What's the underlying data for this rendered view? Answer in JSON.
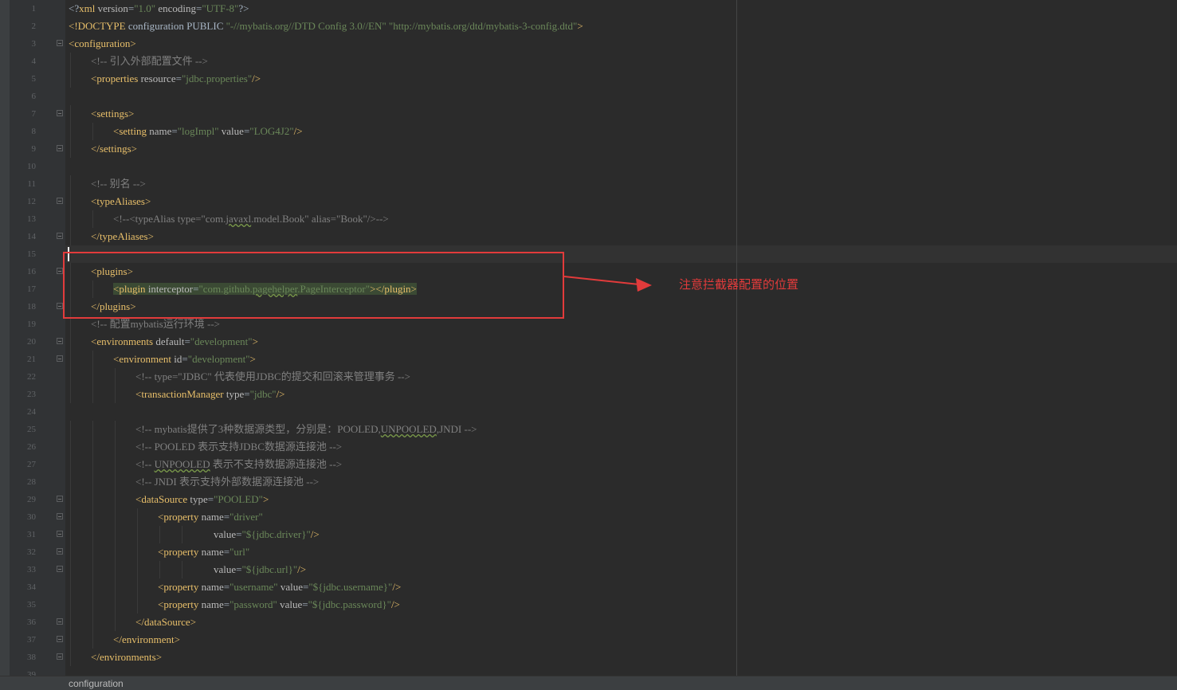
{
  "editor": {
    "lines": [
      {
        "n": "1",
        "indent": 0,
        "fold": false,
        "segments": [
          {
            "t": "p",
            "s": "<?"
          },
          {
            "t": "t",
            "s": "xml "
          },
          {
            "t": "a",
            "s": "version"
          },
          {
            "t": "p",
            "s": "="
          },
          {
            "t": "v",
            "s": "\"1.0\""
          },
          {
            "t": "p",
            "s": " "
          },
          {
            "t": "a",
            "s": "encoding"
          },
          {
            "t": "p",
            "s": "="
          },
          {
            "t": "v",
            "s": "\"UTF-8\""
          },
          {
            "t": "p",
            "s": "?>"
          }
        ]
      },
      {
        "n": "2",
        "indent": 0,
        "fold": false,
        "segments": [
          {
            "t": "t",
            "s": "<!DOCTYPE "
          },
          {
            "t": "p",
            "s": "configuration PUBLIC "
          },
          {
            "t": "v",
            "s": "\"-//mybatis.org//DTD Config 3.0//EN\" \"http://mybatis.org/dtd/mybatis-3-config.dtd\""
          },
          {
            "t": "t",
            "s": ">"
          }
        ]
      },
      {
        "n": "3",
        "indent": 0,
        "fold": true,
        "segments": [
          {
            "t": "t",
            "s": "<configuration>"
          }
        ]
      },
      {
        "n": "4",
        "indent": 1,
        "fold": false,
        "segments": [
          {
            "t": "c",
            "s": "<!-- 引入外部配置文件 -->"
          }
        ]
      },
      {
        "n": "5",
        "indent": 1,
        "fold": false,
        "segments": [
          {
            "t": "t",
            "s": "<properties "
          },
          {
            "t": "a",
            "s": "resource"
          },
          {
            "t": "p",
            "s": "="
          },
          {
            "t": "v",
            "s": "\"jdbc.properties\""
          },
          {
            "t": "t",
            "s": "/>"
          }
        ]
      },
      {
        "n": "6",
        "indent": 0,
        "fold": false,
        "segments": []
      },
      {
        "n": "7",
        "indent": 1,
        "fold": true,
        "segments": [
          {
            "t": "t",
            "s": "<settings>"
          }
        ]
      },
      {
        "n": "8",
        "indent": 2,
        "fold": false,
        "segments": [
          {
            "t": "t",
            "s": "<setting "
          },
          {
            "t": "a",
            "s": "name"
          },
          {
            "t": "p",
            "s": "="
          },
          {
            "t": "v",
            "s": "\"logImpl\""
          },
          {
            "t": "p",
            "s": " "
          },
          {
            "t": "a",
            "s": "value"
          },
          {
            "t": "p",
            "s": "="
          },
          {
            "t": "v",
            "s": "\"LOG4J2\""
          },
          {
            "t": "t",
            "s": "/>"
          }
        ]
      },
      {
        "n": "9",
        "indent": 1,
        "fold": true,
        "segments": [
          {
            "t": "t",
            "s": "</settings>"
          }
        ]
      },
      {
        "n": "10",
        "indent": 0,
        "fold": false,
        "segments": []
      },
      {
        "n": "11",
        "indent": 1,
        "fold": false,
        "segments": [
          {
            "t": "c",
            "s": "<!-- 别名 -->"
          }
        ]
      },
      {
        "n": "12",
        "indent": 1,
        "fold": true,
        "segments": [
          {
            "t": "t",
            "s": "<typeAliases>"
          }
        ]
      },
      {
        "n": "13",
        "indent": 2,
        "fold": false,
        "segments": [
          {
            "t": "c",
            "s": "<!--<typeAlias type=\"com."
          },
          {
            "t": "cu",
            "s": "javaxl"
          },
          {
            "t": "c",
            "s": ".model.Book\" alias=\"Book\"/>-->"
          }
        ]
      },
      {
        "n": "14",
        "indent": 1,
        "fold": true,
        "segments": [
          {
            "t": "t",
            "s": "</typeAliases>"
          }
        ]
      },
      {
        "n": "15",
        "indent": 0,
        "fold": false,
        "segments": []
      },
      {
        "n": "16",
        "indent": 1,
        "fold": true,
        "segments": [
          {
            "t": "t",
            "s": "<plugins>"
          }
        ]
      },
      {
        "n": "17",
        "indent": 2,
        "fold": false,
        "hl": true,
        "segments": [
          {
            "t": "t",
            "s": "<plugin "
          },
          {
            "t": "a",
            "s": "interceptor"
          },
          {
            "t": "p",
            "s": "="
          },
          {
            "t": "v",
            "s": "\"com.github."
          },
          {
            "t": "vu",
            "s": "pagehelper"
          },
          {
            "t": "v",
            "s": ".PageInterceptor\""
          },
          {
            "t": "t",
            "s": "></plugin>"
          }
        ]
      },
      {
        "n": "18",
        "indent": 1,
        "fold": true,
        "segments": [
          {
            "t": "t",
            "s": "</plugins>"
          }
        ]
      },
      {
        "n": "19",
        "indent": 1,
        "fold": false,
        "segments": [
          {
            "t": "c",
            "s": "<!-- 配置mybatis运行环境 -->"
          }
        ]
      },
      {
        "n": "20",
        "indent": 1,
        "fold": true,
        "segments": [
          {
            "t": "t",
            "s": "<environments "
          },
          {
            "t": "a",
            "s": "default"
          },
          {
            "t": "p",
            "s": "="
          },
          {
            "t": "v",
            "s": "\"development\""
          },
          {
            "t": "t",
            "s": ">"
          }
        ]
      },
      {
        "n": "21",
        "indent": 2,
        "fold": true,
        "segments": [
          {
            "t": "t",
            "s": "<environment "
          },
          {
            "t": "a",
            "s": "id"
          },
          {
            "t": "p",
            "s": "="
          },
          {
            "t": "v",
            "s": "\"development\""
          },
          {
            "t": "t",
            "s": ">"
          }
        ]
      },
      {
        "n": "22",
        "indent": 3,
        "fold": false,
        "segments": [
          {
            "t": "c",
            "s": "<!-- type=\"JDBC\" 代表使用JDBC的提交和回滚来管理事务 -->"
          }
        ]
      },
      {
        "n": "23",
        "indent": 3,
        "fold": false,
        "segments": [
          {
            "t": "t",
            "s": "<transactionManager "
          },
          {
            "t": "a",
            "s": "type"
          },
          {
            "t": "p",
            "s": "="
          },
          {
            "t": "v",
            "s": "\"jdbc\""
          },
          {
            "t": "t",
            "s": "/>"
          }
        ]
      },
      {
        "n": "24",
        "indent": 0,
        "fold": false,
        "segments": []
      },
      {
        "n": "25",
        "indent": 3,
        "fold": false,
        "segments": [
          {
            "t": "c",
            "s": "<!-- mybatis提供了3种数据源类型，分别是：POOLED,"
          },
          {
            "t": "cu",
            "s": "UNPOOLED"
          },
          {
            "t": "c",
            "s": ",JNDI -->"
          }
        ]
      },
      {
        "n": "26",
        "indent": 3,
        "fold": false,
        "segments": [
          {
            "t": "c",
            "s": "<!-- POOLED 表示支持JDBC数据源连接池 -->"
          }
        ]
      },
      {
        "n": "27",
        "indent": 3,
        "fold": false,
        "segments": [
          {
            "t": "c",
            "s": "<!-- "
          },
          {
            "t": "cu",
            "s": "UNPOOLED"
          },
          {
            "t": "c",
            "s": " 表示不支持数据源连接池 -->"
          }
        ]
      },
      {
        "n": "28",
        "indent": 3,
        "fold": false,
        "segments": [
          {
            "t": "c",
            "s": "<!-- JNDI 表示支持外部数据源连接池 -->"
          }
        ]
      },
      {
        "n": "29",
        "indent": 3,
        "fold": true,
        "segments": [
          {
            "t": "t",
            "s": "<dataSource "
          },
          {
            "t": "a",
            "s": "type"
          },
          {
            "t": "p",
            "s": "="
          },
          {
            "t": "v",
            "s": "\"POOLED\""
          },
          {
            "t": "t",
            "s": ">"
          }
        ]
      },
      {
        "n": "30",
        "indent": 4,
        "fold": true,
        "segments": [
          {
            "t": "t",
            "s": "<property "
          },
          {
            "t": "a",
            "s": "name"
          },
          {
            "t": "p",
            "s": "="
          },
          {
            "t": "v",
            "s": "\"driver\""
          }
        ]
      },
      {
        "n": "31",
        "indent": 6.5,
        "fold": true,
        "segments": [
          {
            "t": "a",
            "s": "value"
          },
          {
            "t": "p",
            "s": "="
          },
          {
            "t": "v",
            "s": "\"${jdbc.driver}\""
          },
          {
            "t": "t",
            "s": "/>"
          }
        ]
      },
      {
        "n": "32",
        "indent": 4,
        "fold": true,
        "segments": [
          {
            "t": "t",
            "s": "<property "
          },
          {
            "t": "a",
            "s": "name"
          },
          {
            "t": "p",
            "s": "="
          },
          {
            "t": "v",
            "s": "\"url\""
          }
        ]
      },
      {
        "n": "33",
        "indent": 6.5,
        "fold": true,
        "segments": [
          {
            "t": "a",
            "s": "value"
          },
          {
            "t": "p",
            "s": "="
          },
          {
            "t": "v",
            "s": "\"${jdbc.url}\""
          },
          {
            "t": "t",
            "s": "/>"
          }
        ]
      },
      {
        "n": "34",
        "indent": 4,
        "fold": false,
        "segments": [
          {
            "t": "t",
            "s": "<property "
          },
          {
            "t": "a",
            "s": "name"
          },
          {
            "t": "p",
            "s": "="
          },
          {
            "t": "v",
            "s": "\"username\""
          },
          {
            "t": "p",
            "s": " "
          },
          {
            "t": "a",
            "s": "value"
          },
          {
            "t": "p",
            "s": "="
          },
          {
            "t": "v",
            "s": "\"${jdbc.username}\""
          },
          {
            "t": "t",
            "s": "/>"
          }
        ]
      },
      {
        "n": "35",
        "indent": 4,
        "fold": false,
        "segments": [
          {
            "t": "t",
            "s": "<property "
          },
          {
            "t": "a",
            "s": "name"
          },
          {
            "t": "p",
            "s": "="
          },
          {
            "t": "v",
            "s": "\"password\""
          },
          {
            "t": "p",
            "s": " "
          },
          {
            "t": "a",
            "s": "value"
          },
          {
            "t": "p",
            "s": "="
          },
          {
            "t": "v",
            "s": "\"${jdbc.password}\""
          },
          {
            "t": "t",
            "s": "/>"
          }
        ]
      },
      {
        "n": "36",
        "indent": 3,
        "fold": true,
        "segments": [
          {
            "t": "t",
            "s": "</dataSource>"
          }
        ]
      },
      {
        "n": "37",
        "indent": 2,
        "fold": true,
        "segments": [
          {
            "t": "t",
            "s": "</environment>"
          }
        ]
      },
      {
        "n": "38",
        "indent": 1,
        "fold": true,
        "segments": [
          {
            "t": "t",
            "s": "</environments>"
          }
        ]
      },
      {
        "n": "39",
        "indent": 0,
        "fold": false,
        "segments": []
      }
    ]
  },
  "annotation": {
    "text": "注意拦截器配置的位置",
    "color": "#e23b3b"
  },
  "breadcrumb": {
    "text": "configuration"
  },
  "colors": {
    "tag": "#e8bf6a",
    "attribute": "#bababa",
    "value": "#6a8759",
    "comment": "#808080",
    "background": "#2b2b2b",
    "gutter": "#313335"
  }
}
